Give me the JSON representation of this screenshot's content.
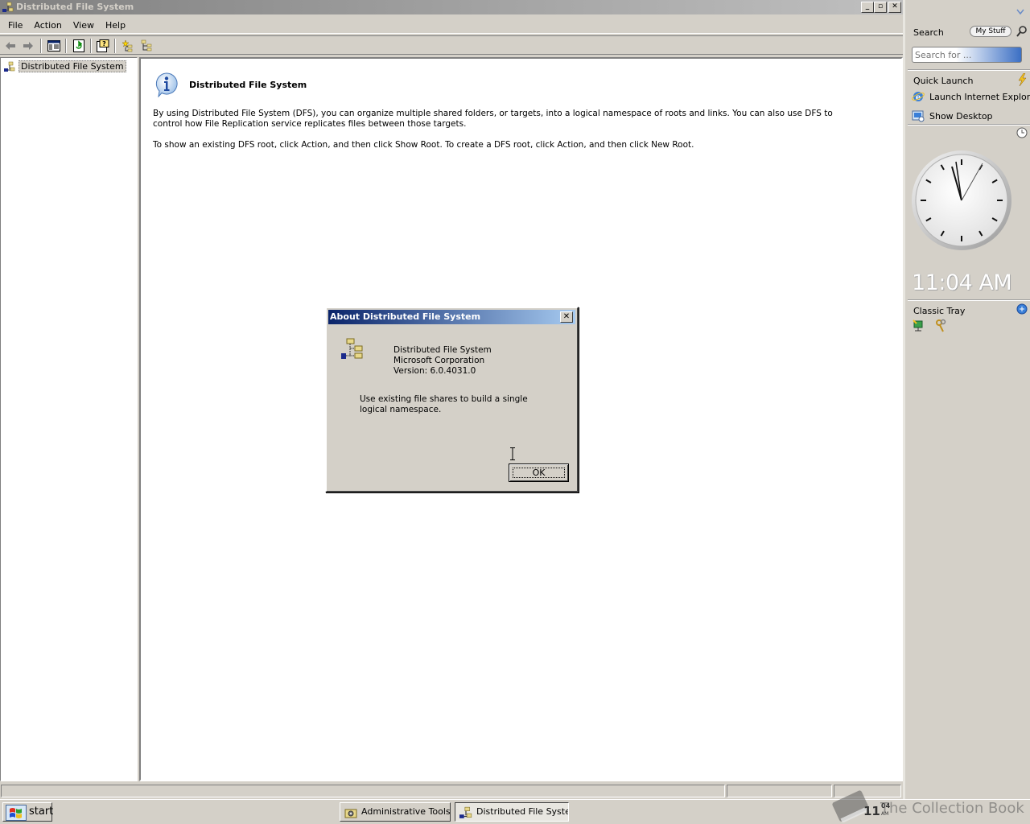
{
  "window": {
    "title": "Distributed File System",
    "min_label": "_",
    "max_label": "▫",
    "close_label": "✕"
  },
  "menu": [
    "File",
    "Action",
    "View",
    "Help"
  ],
  "tree": {
    "root_label": "Distributed File System"
  },
  "result": {
    "title": "Distributed File System",
    "paragraph1": "By using Distributed File System (DFS), you can organize multiple shared folders, or targets, into a logical namespace of roots and links. You can also use DFS to control how File Replication service replicates files between those targets.",
    "paragraph2": "To show an existing DFS root, click Action, and then click Show Root. To create a DFS root, click Action, and then click New Root."
  },
  "dialog": {
    "title": "About Distributed File System",
    "close_label": "✕",
    "product": "Distributed File System",
    "company": "Microsoft Corporation",
    "version": "Version: 6.0.4031.0",
    "description": "Use existing file shares to build a single logical namespace.",
    "ok_label": "OK"
  },
  "taskbar": {
    "start_label": "start",
    "tasks": [
      "Administrative Tools",
      "Distributed File Syster"
    ],
    "clock_hour": "11",
    "clock_min": "04",
    "clock_ampm": "AM",
    "watermark": "The Collection Book"
  },
  "sidebar": {
    "search_label": "Search",
    "mystuff_label": "My Stuff",
    "search_placeholder": "Search for ...",
    "quick_launch_label": "Quick Launch",
    "quick_launch_items": [
      "Launch Internet Explorer Browser",
      "Show Desktop"
    ],
    "clock_time": "11:04 AM",
    "classic_tray_label": "Classic Tray"
  },
  "colors": {
    "dialog_title_start": "#0a246a",
    "dialog_title_end": "#a6caf0",
    "face": "#d4d0c8"
  },
  "icons": [
    "dfs-icon",
    "info-icon",
    "back-icon",
    "forward-icon",
    "refresh-icon",
    "help-icon",
    "search-icon",
    "ie-icon",
    "show-desktop-icon",
    "clock-icon"
  ]
}
